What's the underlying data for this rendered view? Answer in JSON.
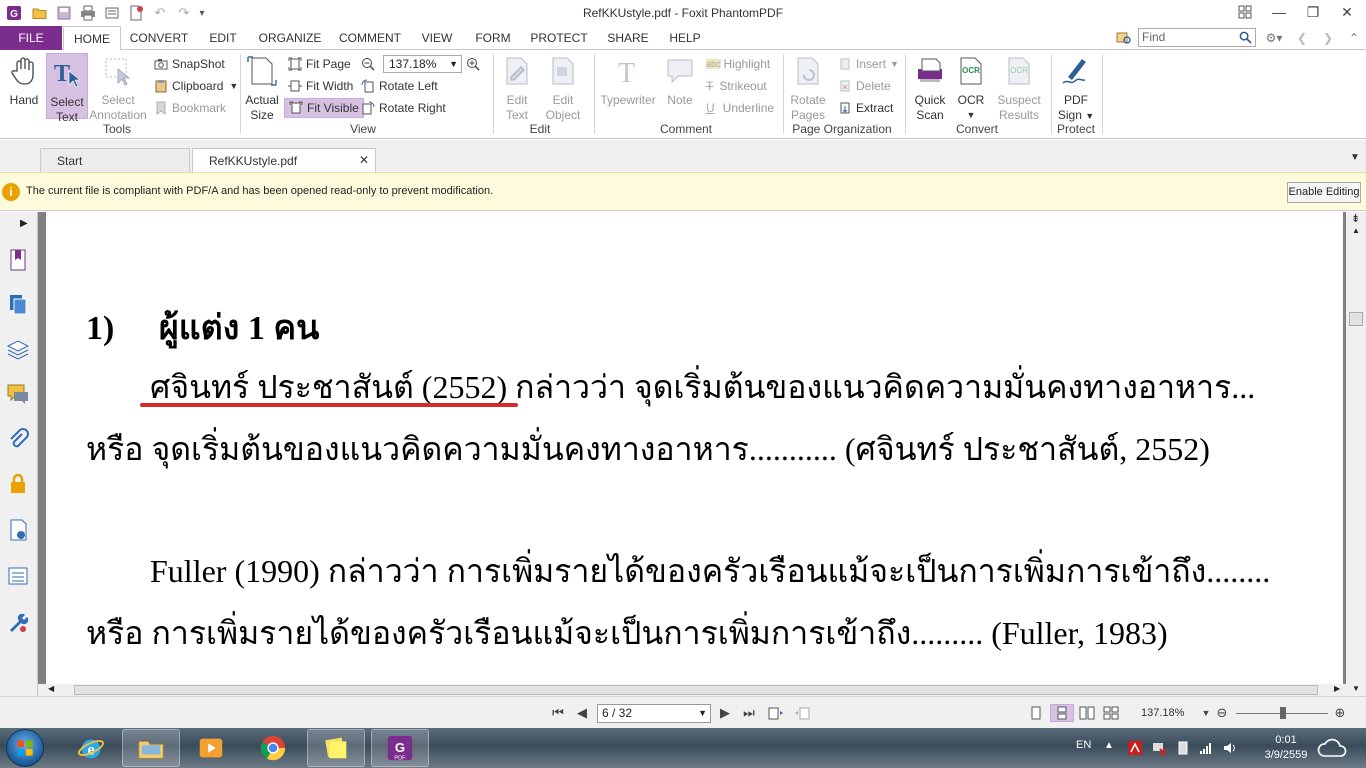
{
  "window": {
    "title": "RefKKUstyle.pdf - Foxit PhantomPDF"
  },
  "menu": {
    "file": "FILE",
    "tabs": [
      "HOME",
      "CONVERT",
      "EDIT",
      "ORGANIZE",
      "COMMENT",
      "VIEW",
      "FORM",
      "PROTECT",
      "SHARE",
      "HELP"
    ],
    "find_placeholder": "Find"
  },
  "ribbon": {
    "tools": {
      "hand": "Hand",
      "select_text_1": "Select",
      "select_text_2": "Text",
      "select_annotation_1": "Select",
      "select_annotation_2": "Annotation",
      "snapshot": "SnapShot",
      "clipboard": "Clipboard",
      "bookmark": "Bookmark",
      "label": "Tools"
    },
    "view": {
      "actual_size_1": "Actual",
      "actual_size_2": "Size",
      "fit_page": "Fit Page",
      "fit_width": "Fit Width",
      "fit_visible": "Fit Visible",
      "zoom_value": "137.18%",
      "rotate_left": "Rotate Left",
      "rotate_right": "Rotate Right",
      "label": "View"
    },
    "edit": {
      "edit_text_1": "Edit",
      "edit_text_2": "Text",
      "edit_object_1": "Edit",
      "edit_object_2": "Object",
      "label": "Edit"
    },
    "comment": {
      "typewriter": "Typewriter",
      "note": "Note",
      "highlight": "Highlight",
      "strikeout": "Strikeout",
      "underline": "Underline",
      "label": "Comment"
    },
    "page_org": {
      "rotate_pages_1": "Rotate",
      "rotate_pages_2": "Pages",
      "insert": "Insert",
      "delete": "Delete",
      "extract": "Extract",
      "label": "Page Organization"
    },
    "convert": {
      "quick_scan_1": "Quick",
      "quick_scan_2": "Scan",
      "ocr": "OCR",
      "suspect_results_1": "Suspect",
      "suspect_results_2": "Results",
      "label": "Convert"
    },
    "protect": {
      "pdf_sign_1": "PDF",
      "pdf_sign_2": "Sign",
      "label": "Protect"
    }
  },
  "doc_tabs": {
    "start": "Start",
    "active": "RefKKUstyle.pdf"
  },
  "infobar": {
    "message": "The current file is compliant with PDF/A and has been opened read-only to prevent modification.",
    "button": "Enable Editing"
  },
  "document": {
    "heading_num": "1)",
    "heading_text": "ผู้แต่ง 1 คน",
    "line1": "ศจินทร์ ประชาสันต์ (2552) กล่าวว่า จุดเริ่มต้นของแนวคิดความมั่นคงทางอาหาร...",
    "line2": "หรือ จุดเริ่มต้นของแนวคิดความมั่นคงทางอาหาร........... (ศจินทร์ ประชาสันต์, 2552)",
    "line3": "Fuller (1990)  กล่าวว่า การเพิ่มรายได้ของครัวเรือนแม้จะเป็นการเพิ่มการเข้าถึง........",
    "line4": "หรือ การเพิ่มรายได้ของครัวเรือนแม้จะเป็นการเพิ่มการเข้าถึง......... (Fuller, 1983)"
  },
  "statusbar": {
    "page": "6 / 32",
    "zoom": "137.18%"
  },
  "taskbar": {
    "lang": "EN",
    "time": "0:01",
    "date": "3/9/2559"
  },
  "colors": {
    "file_tab": "#7b2d8e",
    "selected_button": "#d7c1e3",
    "annotation_underline": "#d42a2a",
    "infobar_bg": "#fdfbdc"
  }
}
